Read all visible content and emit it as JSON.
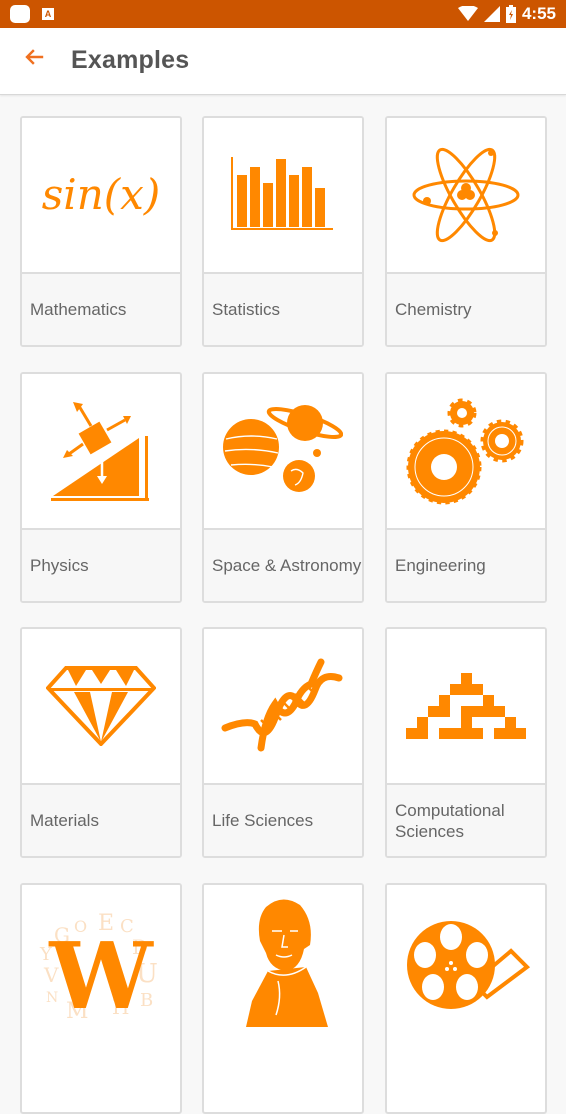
{
  "status_bar": {
    "time": "4:55",
    "icons": [
      "app-icon",
      "a-notification-icon",
      "wifi-icon",
      "signal-icon",
      "battery-charging-icon"
    ]
  },
  "app_bar": {
    "title": "Examples",
    "back_icon": "arrow-left-icon"
  },
  "colors": {
    "status_bar": "#cc5500",
    "accent": "#ff8800",
    "label_text": "#666666",
    "title_text": "#555555"
  },
  "categories": [
    {
      "label": "Mathematics",
      "icon": "sin-x-icon"
    },
    {
      "label": "Statistics",
      "icon": "bar-chart-icon"
    },
    {
      "label": "Chemistry",
      "icon": "atom-icon"
    },
    {
      "label": "Physics",
      "icon": "inclined-plane-icon"
    },
    {
      "label": "Space & Astronomy",
      "icon": "planets-icon"
    },
    {
      "label": "Engineering",
      "icon": "gears-icon"
    },
    {
      "label": "Materials",
      "icon": "diamond-icon"
    },
    {
      "label": "Life Sciences",
      "icon": "dna-icon"
    },
    {
      "label": "Computational Sciences",
      "icon": "cellular-automaton-icon"
    },
    {
      "label": "",
      "icon": "words-letters-icon"
    },
    {
      "label": "",
      "icon": "portrait-icon"
    },
    {
      "label": "",
      "icon": "film-reel-icon"
    }
  ]
}
